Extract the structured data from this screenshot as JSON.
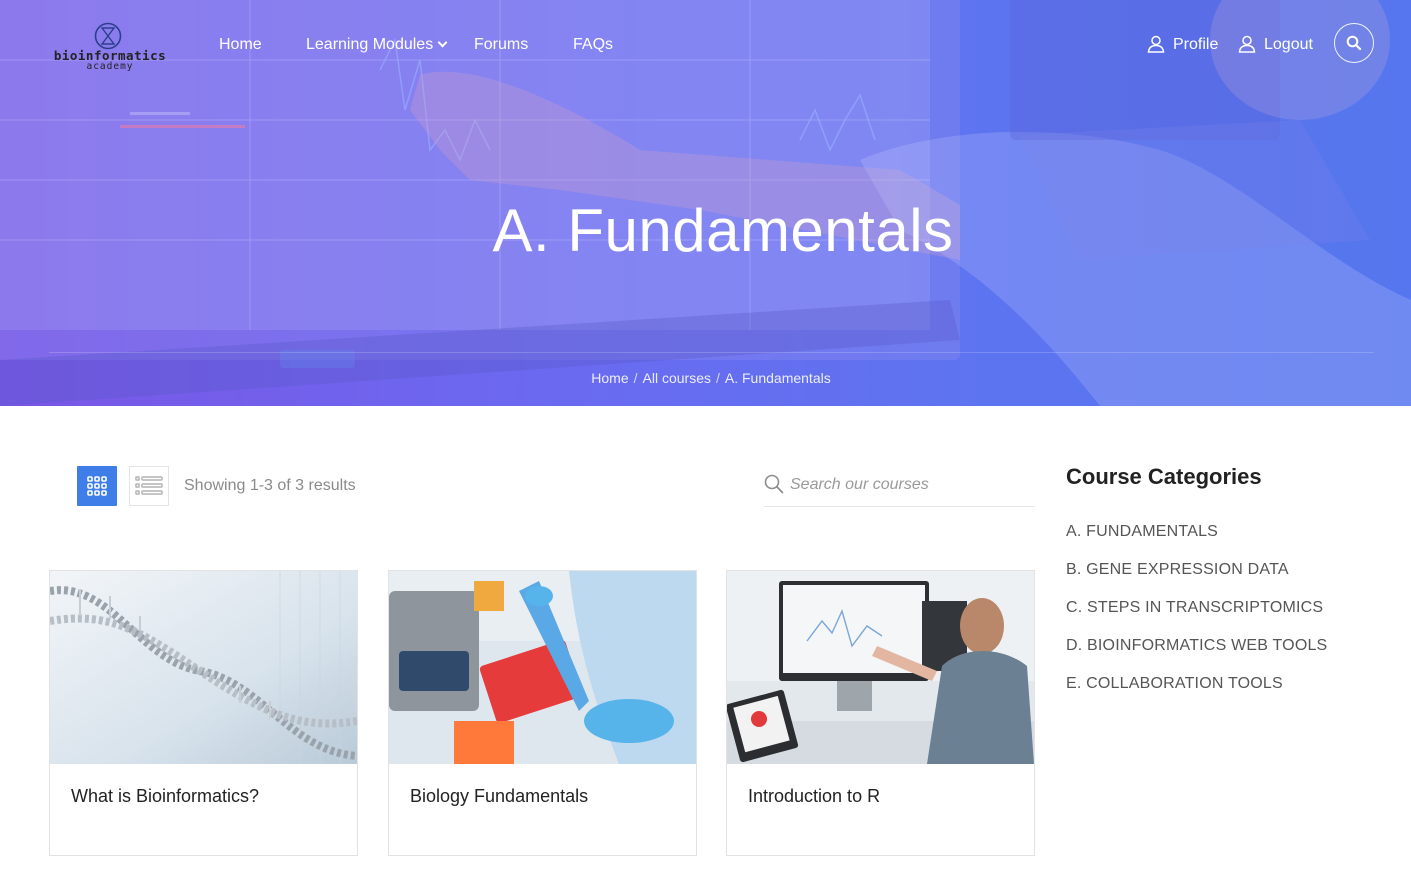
{
  "brand": {
    "name": "bioinformatics",
    "sub": "academy"
  },
  "nav": {
    "home": "Home",
    "learning_modules": "Learning Modules",
    "forums": "Forums",
    "faqs": "FAQs"
  },
  "user": {
    "profile": "Profile",
    "logout": "Logout"
  },
  "hero": {
    "title": "A. Fundamentals"
  },
  "breadcrumb": [
    "Home",
    "All courses",
    "A. Fundamentals"
  ],
  "toolbar": {
    "results_text": "Showing 1-3 of 3 results",
    "search_placeholder": "Search our courses"
  },
  "courses": [
    {
      "title": "What is Bioinformatics?"
    },
    {
      "title": "Biology Fundamentals"
    },
    {
      "title": "Introduction to R"
    }
  ],
  "sidebar": {
    "title": "Course Categories",
    "categories": [
      "A. FUNDAMENTALS",
      "B. GENE EXPRESSION DATA",
      "C. STEPS IN TRANSCRIPTOMICS",
      "D. BIOINFORMATICS WEB TOOLS",
      "E. COLLABORATION TOOLS"
    ]
  },
  "colors": {
    "accent": "#3f7ee8",
    "hero_start": "#7a56e6",
    "hero_end": "#5576ee"
  }
}
